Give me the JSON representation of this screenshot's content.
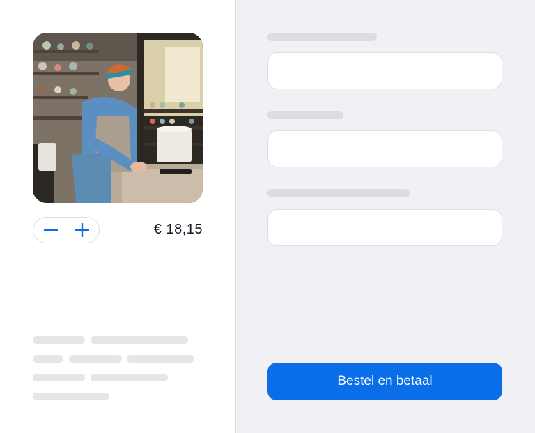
{
  "product": {
    "image_icon": "photo-of-potter-in-workshop",
    "price": "€ 18,15"
  },
  "quantity": {
    "decrement_icon": "minus-icon",
    "increment_icon": "plus-icon"
  },
  "checkout": {
    "submit_label": "Bestel en betaal"
  },
  "colors": {
    "accent": "#0a6ee8",
    "panel_background": "#f1f0f5",
    "skeleton": "#e6e6ea"
  }
}
